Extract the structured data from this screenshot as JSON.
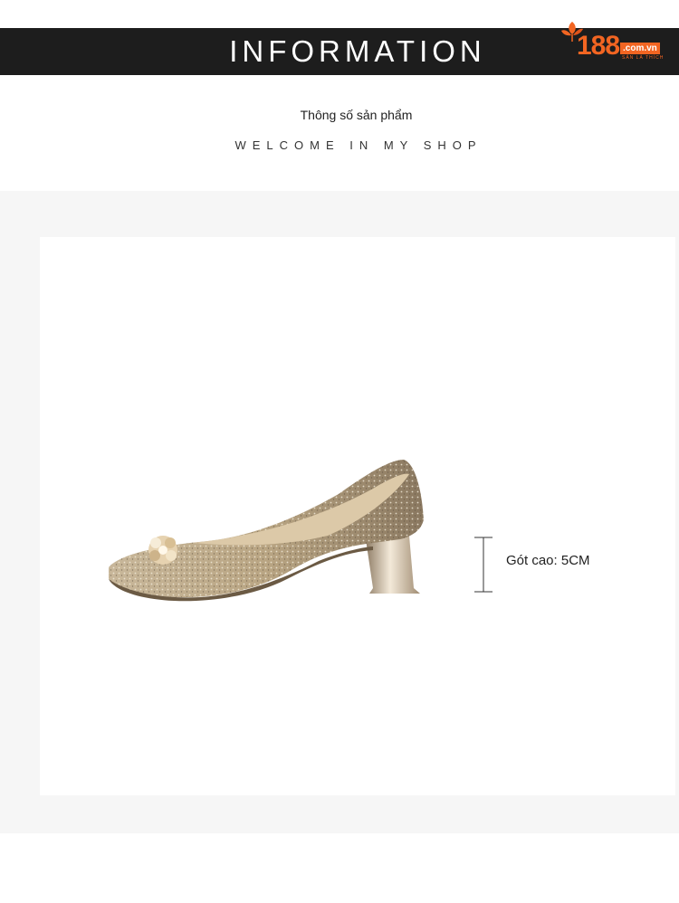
{
  "header": {
    "title": "INFORMATION"
  },
  "logo": {
    "number": "188",
    "domain": ".com.vn",
    "tagline": "SẢN LÀ THÍCH"
  },
  "intro": {
    "subtitle": "Thông số sản phẩm",
    "welcome": "WELCOME IN MY SHOP"
  },
  "product": {
    "image": "gold-glitter-pump-shoe",
    "heel_label": "Gót cao: 5CM"
  },
  "colors": {
    "banner_bg": "#1d1d1d",
    "brand_orange": "#f26522",
    "section_bg": "#f6f6f6"
  }
}
